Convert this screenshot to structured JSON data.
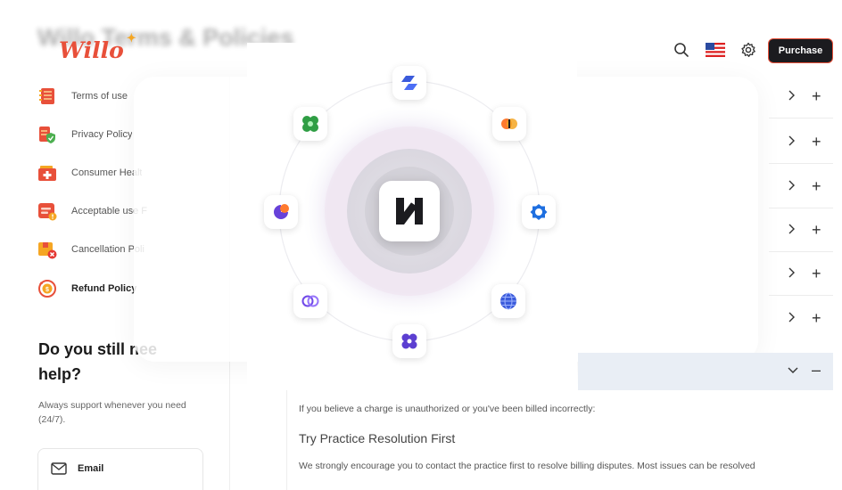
{
  "header": {
    "background_title": "Willo Terms & Policies",
    "logo": "Willo",
    "purchase_label": "Purchase",
    "icons": [
      "search-icon",
      "us-flag-icon",
      "gear-icon"
    ],
    "accent": "#e8503a"
  },
  "sidebar": {
    "items": [
      {
        "label": "Terms of use",
        "icon": "notebook-icon"
      },
      {
        "label": "Privacy Policy",
        "icon": "shield-doc-icon"
      },
      {
        "label": "Consumer Healt",
        "icon": "health-folder-icon"
      },
      {
        "label": "Acceptable use F",
        "icon": "warning-doc-icon"
      },
      {
        "label": "Cancellation Poli",
        "icon": "cancel-box-icon"
      },
      {
        "label": "Refund Policy",
        "icon": "refund-icon",
        "active": true
      }
    ],
    "help_title": "Do you still nee\nhelp?",
    "help_subtitle": "Always support whenever you need (24/7).",
    "email_label": "Email"
  },
  "content": {
    "intro": "If you believe a charge is unauthorized or you've been billed incorrectly:",
    "heading": "Try Practice Resolution First",
    "body": "We strongly encourage you to contact the practice first to resolve billing disputes. Most issues can be resolved"
  },
  "integrations": {
    "center": "N",
    "tiles": [
      "linear-icon",
      "orange-half-icon",
      "blue-ring-icon",
      "globe-icon",
      "clover-icon",
      "chain-icon",
      "pie-icon",
      "green-flower-icon"
    ]
  }
}
